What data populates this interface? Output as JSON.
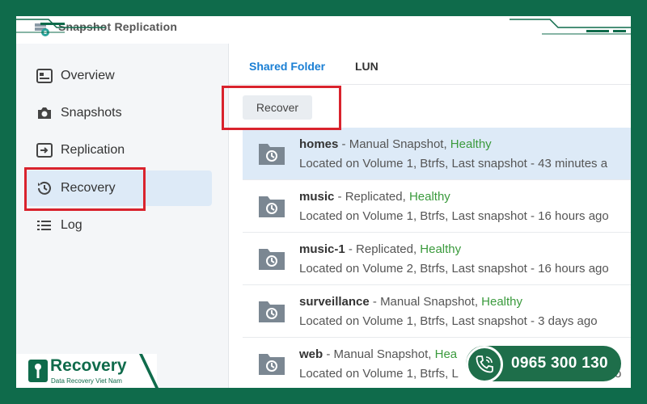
{
  "window": {
    "title": "Snapshot Replication"
  },
  "sidebar": {
    "items": [
      {
        "label": "Overview",
        "icon": "overview-icon"
      },
      {
        "label": "Snapshots",
        "icon": "camera-icon"
      },
      {
        "label": "Replication",
        "icon": "replication-icon"
      },
      {
        "label": "Recovery",
        "icon": "history-icon",
        "active": true
      },
      {
        "label": "Log",
        "icon": "list-icon"
      }
    ]
  },
  "tabs": [
    {
      "label": "Shared Folder",
      "active": true
    },
    {
      "label": "LUN",
      "active": false
    }
  ],
  "toolbar": {
    "recover_label": "Recover"
  },
  "rows": [
    {
      "name": "homes",
      "type": "Manual Snapshot",
      "status": "Healthy",
      "info": "Located on Volume 1, Btrfs, Last snapshot - 43 minutes a",
      "selected": true
    },
    {
      "name": "music",
      "type": "Replicated",
      "status": "Healthy",
      "info": "Located on Volume 1, Btrfs, Last snapshot - 16 hours ago",
      "selected": false
    },
    {
      "name": "music-1",
      "type": "Replicated",
      "status": "Healthy",
      "info": "Located on Volume 2, Btrfs, Last snapshot - 16 hours ago",
      "selected": false
    },
    {
      "name": "surveillance",
      "type": "Manual Snapshot",
      "status": "Healthy",
      "info": "Located on Volume 1, Btrfs, Last snapshot - 3 days ago",
      "selected": false
    },
    {
      "name": "web",
      "type": "Manual Snapshot",
      "status": "Hea",
      "info": "Located on Volume 1, Btrfs, L",
      "info_tail": "o",
      "selected": false
    }
  ],
  "brand": {
    "name": "Recovery",
    "tagline": "Data Recovery Viet Nam"
  },
  "contact": {
    "phone": "0965 300 130"
  },
  "colors": {
    "accent": "#1a7fd4",
    "healthy": "#3a9a3c",
    "highlight": "#d9232d",
    "brand_green": "#1e6e4a"
  }
}
